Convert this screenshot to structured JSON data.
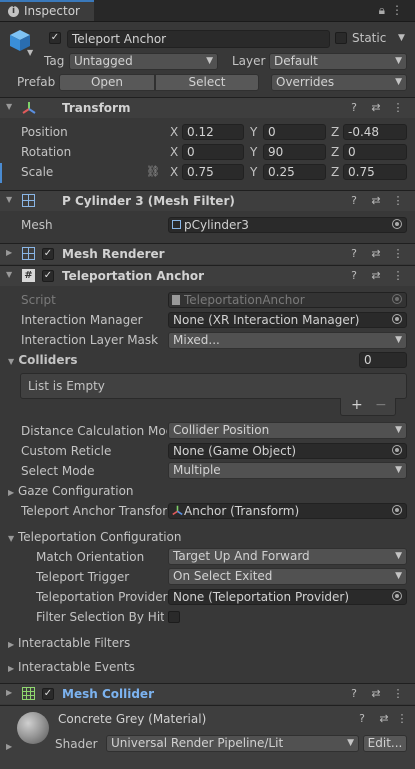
{
  "tab": {
    "title": "Inspector"
  },
  "object": {
    "name": "Teleport Anchor",
    "static_label": "Static",
    "tag_label": "Tag",
    "tag_value": "Untagged",
    "layer_label": "Layer",
    "layer_value": "Default",
    "prefab_label": "Prefab",
    "open_label": "Open",
    "select_label": "Select",
    "overrides_label": "Overrides"
  },
  "transform": {
    "title": "Transform",
    "position_label": "Position",
    "rotation_label": "Rotation",
    "scale_label": "Scale",
    "x": "X",
    "y": "Y",
    "z": "Z",
    "position": [
      "0.12",
      "0",
      "-0.48"
    ],
    "rotation": [
      "0",
      "90",
      "0"
    ],
    "scale": [
      "0.75",
      "0.25",
      "0.75"
    ]
  },
  "mesh_filter": {
    "title": "P Cylinder 3 (Mesh Filter)",
    "mesh_label": "Mesh",
    "mesh_value": "pCylinder3"
  },
  "mesh_renderer": {
    "title": "Mesh Renderer"
  },
  "teleport_anchor": {
    "title": "Teleportation Anchor",
    "script_label": "Script",
    "script_value": "TeleportationAnchor",
    "interaction_manager_label": "Interaction Manager",
    "interaction_manager_value": "None (XR Interaction Manager)",
    "layer_mask_label": "Interaction Layer Mask",
    "layer_mask_value": "Mixed...",
    "colliders_label": "Colliders",
    "colliders_count": "0",
    "list_empty": "List is Empty",
    "plus": "+",
    "minus": "−",
    "distance_label": "Distance Calculation Mod",
    "distance_value": "Collider Position",
    "reticle_label": "Custom Reticle",
    "reticle_value": "None (Game Object)",
    "select_mode_label": "Select Mode",
    "select_mode_value": "Multiple",
    "gaze_label": "Gaze Configuration",
    "anchor_transform_label": "Teleport Anchor Transforr",
    "anchor_transform_value": "Anchor (Transform)",
    "teleport_config_label": "Teleportation Configuration",
    "match_orientation_label": "Match Orientation",
    "match_orientation_value": "Target Up And Forward",
    "trigger_label": "Teleport Trigger",
    "trigger_value": "On Select Exited",
    "provider_label": "Teleportation Provider",
    "provider_value": "None (Teleportation Provider)",
    "filter_label": "Filter Selection By Hit N",
    "interactable_filters_label": "Interactable Filters",
    "interactable_events_label": "Interactable Events"
  },
  "mesh_collider": {
    "title": "Mesh Collider"
  },
  "material": {
    "name": "Concrete Grey (Material)",
    "shader_label": "Shader",
    "shader_value": "Universal Render Pipeline/Lit",
    "edit_label": "Edit..."
  },
  "colors": {
    "accent": "#3a79bb",
    "collider_title": "#7cb3f0",
    "background": "#383838"
  }
}
